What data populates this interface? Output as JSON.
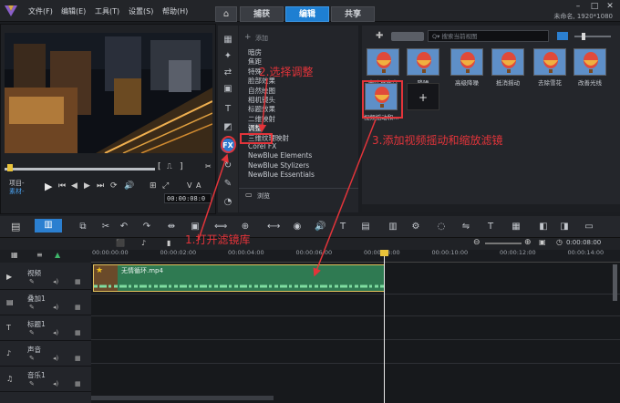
{
  "menu": {
    "file": "文件(F)",
    "edit": "编辑(E)",
    "tools": "工具(T)",
    "settings": "设置(S)",
    "help": "帮助(H)"
  },
  "tabs": {
    "capture": "捕获",
    "edit": "编辑",
    "share": "共享"
  },
  "project_info": "未命名, 1920*1080",
  "preview": {
    "project_label": "项目-",
    "clip_label": "素材-",
    "timecode": "00:00:08:0"
  },
  "library": {
    "add_label": "添加",
    "categories": [
      "暗房",
      "焦距",
      "特殊",
      "脸部效果",
      "自然绘图",
      "相机镜头",
      "标题效果",
      "二维映射",
      "调整",
      "三维纹理映射",
      "Corel FX",
      "NewBlue Elements",
      "NewBlue Stylizers",
      "NewBlue Essentials"
    ],
    "browse_label": "浏览",
    "search_placeholder": "搜索当前视图",
    "filters": [
      "去除马赛克",
      "降噪",
      "高级降噪",
      "抵消摇动",
      "去除雪花",
      "改善光线",
      "视频摇动和..."
    ]
  },
  "timeline": {
    "ruler": [
      "00:00:00:00",
      "00:00:02:00",
      "00:00:04:00",
      "00:00:06:00",
      "00:00:08:00",
      "00:00:10:00",
      "00:00:12:00",
      "00:00:14:00"
    ],
    "timecode": "0:00:08:00",
    "tracks": [
      "视频",
      "叠加1",
      "标题1",
      "声音",
      "音乐1"
    ],
    "clip_name": "无情循环.mp4"
  },
  "annotations": {
    "step1": "1.打开滤镜库",
    "step2": "2.选择调整",
    "step3": "3.添加视频摇动和缩放滤镜"
  },
  "colors": {
    "accent": "#1e7fd2",
    "annotation": "#e3343a",
    "clip": "#2f7a52"
  }
}
